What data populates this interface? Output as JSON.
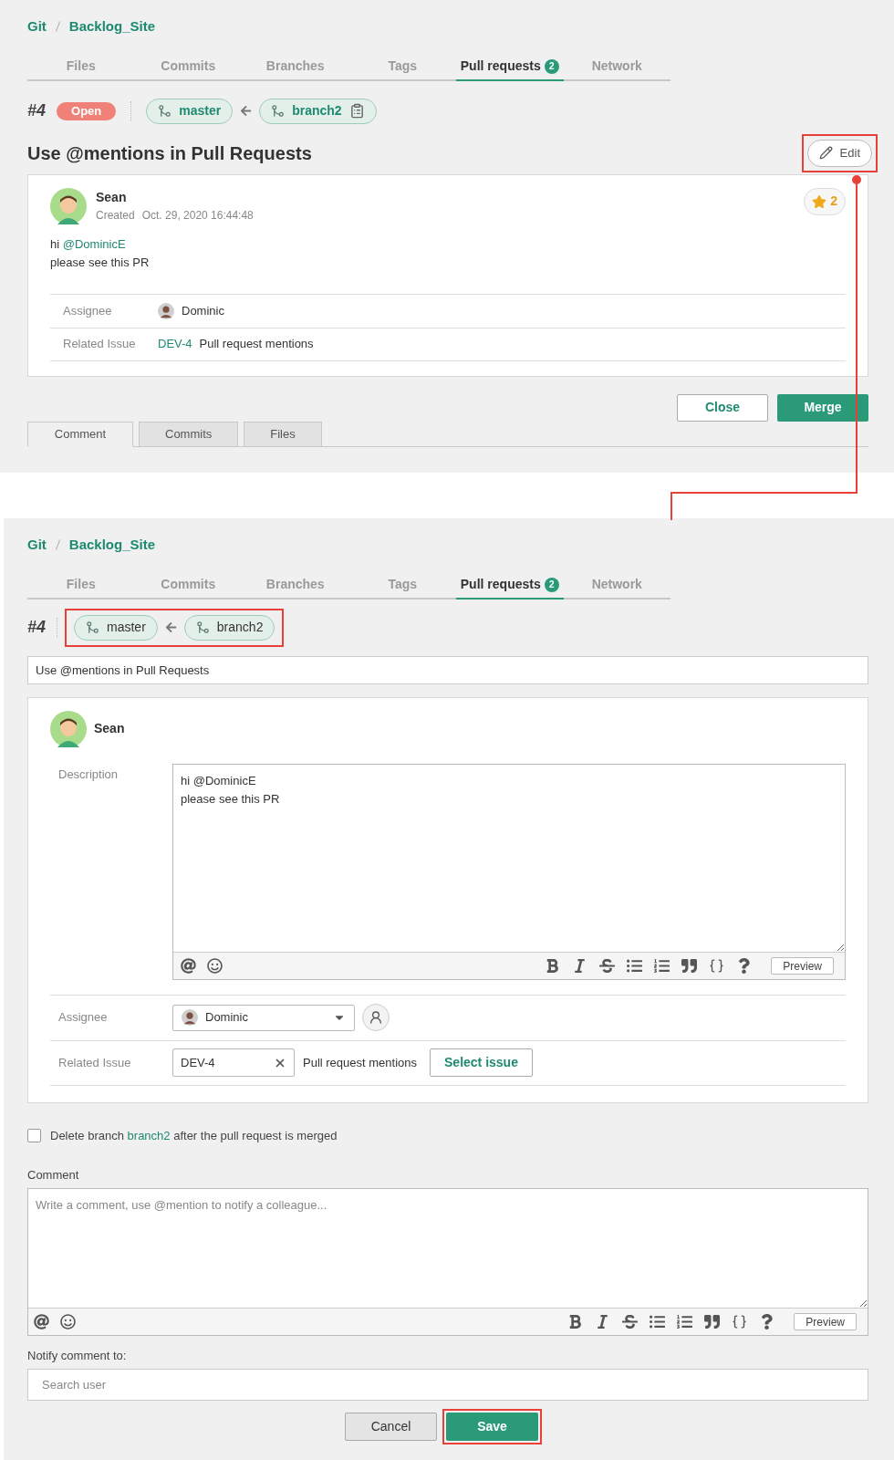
{
  "view_before": {
    "breadcrumb": [
      "Git",
      "Backlog_Site"
    ],
    "tabs": [
      {
        "label": "Files",
        "selected": false
      },
      {
        "label": "Commits",
        "selected": false
      },
      {
        "label": "Branches",
        "selected": false
      },
      {
        "label": "Tags",
        "selected": false
      },
      {
        "label": "Pull requests",
        "badge": "2",
        "selected": true
      },
      {
        "label": "Network",
        "selected": false
      }
    ],
    "pr": {
      "number": "#4",
      "status": "Open",
      "target_branch": "master",
      "source_branch": "branch2",
      "title": "Use @mentions in Pull Requests",
      "edit_button": "Edit",
      "edit_highlighted": true,
      "author": "Sean",
      "created_label": "Created",
      "created_at": "Oct. 29, 2020 16:44:48",
      "star_count": "2",
      "description": [
        {
          "segments": [
            {
              "text": "hi"
            },
            {
              "text": "@DominicE",
              "kind": "mention"
            }
          ]
        },
        {
          "segments": [
            {
              "text": "please see this PR"
            }
          ]
        }
      ],
      "assignee_label": "Assignee",
      "assignee": "Dominic",
      "related_issue_label": "Related Issue",
      "issue_key": "DEV-4",
      "issue_title": "Pull request mentions"
    },
    "actions": [
      "Close",
      "Merge"
    ],
    "bottom_tabs": [
      {
        "label": "Comment",
        "selected": true
      },
      {
        "label": "Commits",
        "selected": false
      },
      {
        "label": "Files",
        "selected": false
      }
    ]
  },
  "view_edit": {
    "breadcrumb": [
      "Git",
      "Backlog_Site"
    ],
    "tabs": [
      {
        "label": "Files",
        "selected": false
      },
      {
        "label": "Commits",
        "selected": false
      },
      {
        "label": "Branches",
        "selected": false
      },
      {
        "label": "Tags",
        "selected": false
      },
      {
        "label": "Pull requests",
        "badge": "2",
        "selected": true
      },
      {
        "label": "Network",
        "selected": false
      }
    ],
    "number": "#4",
    "target_branch": "master",
    "source_branch": "branch2",
    "branches_highlighted": true,
    "title_value": "Use @mentions in Pull Requests",
    "author": "Sean",
    "description_label": "Description",
    "description_value": "hi @DominicE\nplease see this PR",
    "preview_button": "Preview",
    "assignee_label": "Assignee",
    "assignee": "Dominic",
    "related_issue_label": "Related Issue",
    "issue_key": "DEV-4",
    "issue_title": "Pull request mentions",
    "select_issue_button": "Select issue",
    "delete_branch": {
      "checked": false,
      "text_before": "Delete branch",
      "branch": "branch2",
      "text_after": "after the pull request is merged"
    },
    "comment_label": "Comment",
    "comment_placeholder": "Write a comment, use @mention to notify a colleague...",
    "comment_preview_button": "Preview",
    "notify_label": "Notify comment to:",
    "notify_placeholder": "Search user",
    "cancel_button": "Cancel",
    "save_button": "Save",
    "save_highlighted": true
  }
}
